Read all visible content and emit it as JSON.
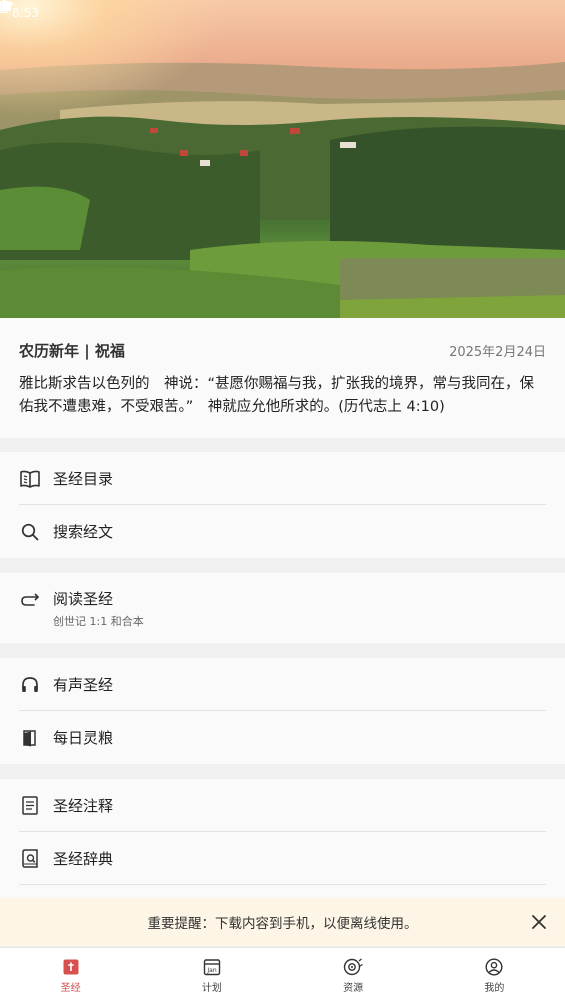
{
  "status_bar": {
    "time": "8:53"
  },
  "devotional": {
    "title": "农历新年 | 祝福",
    "date": "2025年2月24日",
    "verse": "雅比斯求告以色列的　神说：“甚愿你赐福与我，扩张我的境界，常与我同在，保佑我不遭患难，不受艰苦。”　神就应允他所求的。(历代志上 4:10)"
  },
  "menu": {
    "bible_catalog": "圣经目录",
    "search_verses": "搜索经文",
    "read_bible": "阅读圣经",
    "read_bible_sub": "创世记 1:1 和合本",
    "audio_bible": "有声圣经",
    "daily_bread": "每日灵粮",
    "commentary": "圣经注释",
    "dictionary": "圣经辞典"
  },
  "notice": {
    "text": "重要提醒：下载内容到手机，以便离线使用。"
  },
  "bottom_nav": {
    "tabs": [
      {
        "label": "圣经",
        "icon": "bible-icon",
        "active": true
      },
      {
        "label": "计划",
        "icon": "calendar-icon",
        "active": false,
        "icon_text": "Jan"
      },
      {
        "label": "资源",
        "icon": "resources-icon",
        "active": false
      },
      {
        "label": "我的",
        "icon": "profile-icon",
        "active": false
      }
    ]
  },
  "colors": {
    "accent": "#d65050",
    "notice_bg": "#fdf5e6"
  }
}
